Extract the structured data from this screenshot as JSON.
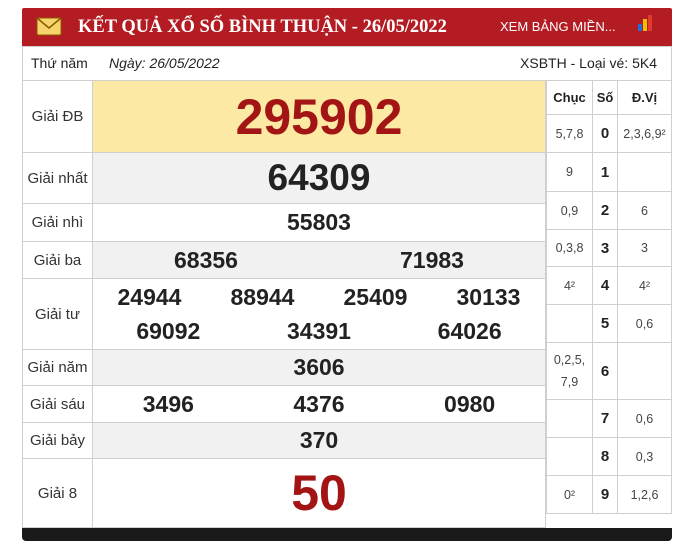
{
  "header": {
    "title": "KẾT QUẢ XỔ SỐ BÌNH THUẬN - 26/05/2022",
    "view_link": "XEM BẢNG MIỀN...",
    "bg_color": "#b31c22"
  },
  "meta": {
    "weekday": "Thứ năm",
    "date": "Ngày: 26/05/2022",
    "code": "XSBTH - Loại vé: 5K4"
  },
  "prizes": [
    {
      "label": "Giải ĐB",
      "values": [
        "295902"
      ]
    },
    {
      "label": "Giải nhất",
      "values": [
        "64309"
      ]
    },
    {
      "label": "Giải nhì",
      "values": [
        "55803"
      ]
    },
    {
      "label": "Giải ba",
      "values": [
        "68356",
        "71983"
      ]
    },
    {
      "label": "Giải tư",
      "values": [
        "24944",
        "88944",
        "25409",
        "30133",
        "69092",
        "34391",
        "64026"
      ]
    },
    {
      "label": "Giải năm",
      "values": [
        "3606"
      ]
    },
    {
      "label": "Giải sáu",
      "values": [
        "3496",
        "4376",
        "0980"
      ]
    },
    {
      "label": "Giải bảy",
      "values": [
        "370"
      ]
    },
    {
      "label": "Giải 8",
      "values": [
        "50"
      ]
    }
  ],
  "loto": {
    "headers": {
      "chuc": "Chục",
      "so": "Số",
      "dvi": "Đ.Vị"
    },
    "rows": [
      {
        "chuc": "5,7,8",
        "so": "0",
        "dvi": "2,3,6,9²"
      },
      {
        "chuc": "9",
        "so": "1",
        "dvi": ""
      },
      {
        "chuc": "0,9",
        "so": "2",
        "dvi": "6"
      },
      {
        "chuc": "0,3,8",
        "so": "3",
        "dvi": "3"
      },
      {
        "chuc": "4²",
        "so": "4",
        "dvi": "4²"
      },
      {
        "chuc": "",
        "so": "5",
        "dvi": "0,6"
      },
      {
        "chuc": "0,2,5,7,9",
        "so": "6",
        "dvi": ""
      },
      {
        "chuc": "",
        "so": "7",
        "dvi": "0,6"
      },
      {
        "chuc": "",
        "so": "8",
        "dvi": "0,3"
      },
      {
        "chuc": "0²",
        "so": "9",
        "dvi": "1,2,6"
      }
    ]
  },
  "icons": {
    "mail": "mail-icon",
    "chart": "bar-chart-icon"
  }
}
